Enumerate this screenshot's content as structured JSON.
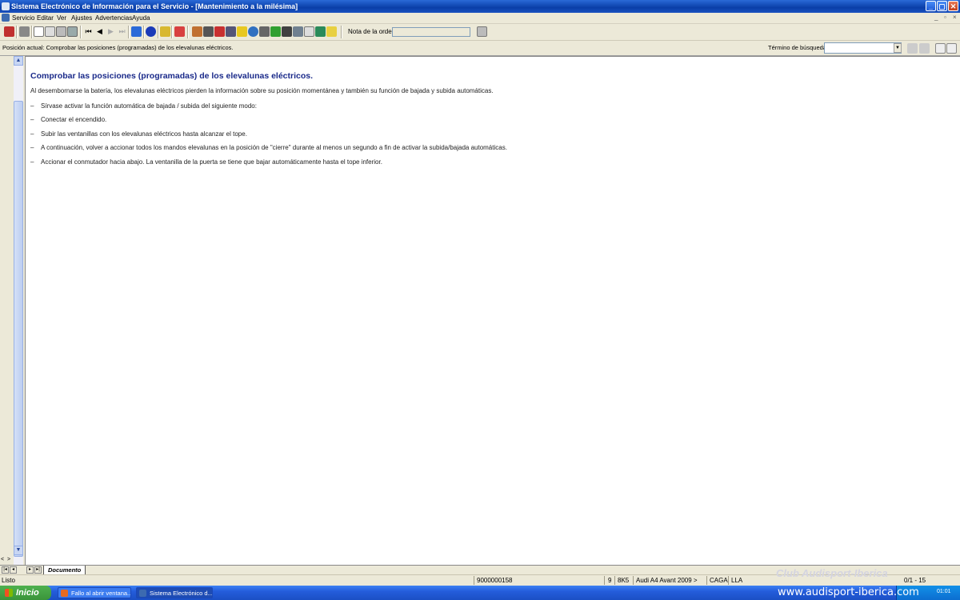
{
  "window": {
    "title": "Sistema Electrónico de Información para el Servicio - [Mantenimiento a la milésima]",
    "btn_minimize": "_",
    "btn_maximize": "▢",
    "btn_close": "✕"
  },
  "menu": {
    "items": [
      "Servicio",
      "Editar",
      "Ver",
      "Ajustes",
      "Advertencias",
      "Ayuda"
    ],
    "mdi_min": "_",
    "mdi_restore": "▫",
    "mdi_close": "×"
  },
  "toolbar": {
    "nota_label": "Nota de la orden:",
    "nota_value": "",
    "icons": [
      "exit-icon",
      "print-icon",
      "new-doc-icon",
      "edit-icon",
      "document-icon",
      "car-icon",
      "first-icon",
      "prev-icon",
      "next-icon",
      "last-icon",
      "back-icon",
      "info-icon",
      "key-icon",
      "refresh-icon",
      "settings-icon",
      "diagnosis-icon",
      "service-icon",
      "wiring-icon",
      "warning-icon",
      "globe-icon",
      "tools-icon",
      "car-green-icon",
      "oil-icon",
      "search-icon",
      "checklist-icon",
      "repair-icon",
      "help-icon"
    ]
  },
  "position": {
    "text": "Posición actual: Comprobar las posiciones (programadas) de los elevalunas eléctricos.",
    "search_label": "Término de búsqueda:",
    "search_value": ""
  },
  "document": {
    "title": "Comprobar las posiciones (programadas) de los elevalunas eléctricos.",
    "intro": "Al desembornarse la batería, los elevalunas eléctricos pierden la información sobre su posición momentánea y también su función de bajada y subida automáticas.",
    "dash": "–",
    "steps": [
      "Sírvase activar la función automática de bajada / subida del siguiente modo:",
      "Conectar el encendido.",
      "Subir las ventanillas con los elevalunas eléctricos hasta alcanzar el tope.",
      "A continuación, volver a accionar todos los mandos elevalunas en la posición de \"cierre\" durante al menos un segundo a fin de activar la subida/bajada automáticas.",
      "Accionar el conmutador hacia abajo. La ventanilla de la puerta se tiene que bajar automáticamente hasta el tope inferior."
    ]
  },
  "tabs": {
    "active": "Documento"
  },
  "status": {
    "ready": "Listo",
    "order": "9000000158",
    "num": "9",
    "code": "8K5",
    "model": "Audi A4 Avant 2009 >",
    "engine": "CAGA",
    "trans": "LLA",
    "page": "0/1 - 15"
  },
  "watermark": "Club Audisport-Iberica",
  "taskbar": {
    "start": "Inicio",
    "task1": "Fallo al abrir ventana...",
    "task2": "Sistema Electrónico d...",
    "site": "www.audisport-iberica.com",
    "clock": "01:01"
  },
  "colors": {
    "title_blue": "#1a2a8a",
    "xp_blue": "#245ddb",
    "start_green": "#3a943a"
  }
}
